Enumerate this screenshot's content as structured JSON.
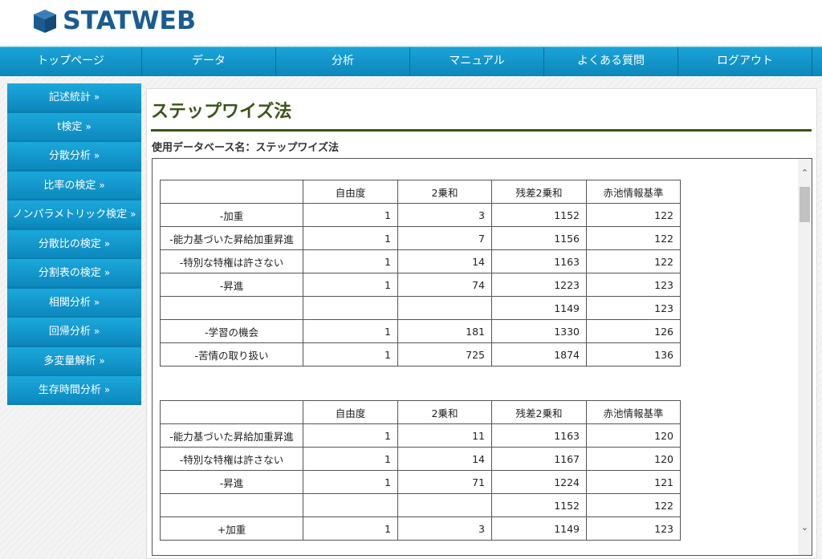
{
  "header": {
    "logo_text": "STATWEB"
  },
  "nav": {
    "items": [
      "トップページ",
      "データ",
      "分析",
      "マニュアル",
      "よくある質問",
      "ログアウト"
    ]
  },
  "sidebar": {
    "chevron": "»",
    "items": [
      "記述統計",
      "t検定",
      "分散分析",
      "比率の検定",
      "ノンパラメトリック検定",
      "分散比の検定",
      "分割表の検定",
      "相関分析",
      "回帰分析",
      "多変量解析",
      "生存時間分析"
    ]
  },
  "main": {
    "title": "ステップワイズ法",
    "db_label": "使用データベース名：ステップワイズ法"
  },
  "tables": [
    {
      "header": [
        "",
        "自由度",
        "2乗和",
        "残差2乗和",
        "赤池情報基準"
      ],
      "rows": [
        [
          "-加重",
          "1",
          "3",
          "1152",
          "122"
        ],
        [
          "-能力基づいた昇給加重昇進",
          "1",
          "7",
          "1156",
          "122"
        ],
        [
          "-特別な特権は許さない",
          "1",
          "14",
          "1163",
          "122"
        ],
        [
          "-昇進",
          "1",
          "74",
          "1223",
          "123"
        ],
        [
          "",
          "",
          "",
          "1149",
          "123"
        ],
        [
          "-学習の機会",
          "1",
          "181",
          "1330",
          "126"
        ],
        [
          "-苦情の取り扱い",
          "1",
          "725",
          "1874",
          "136"
        ]
      ]
    },
    {
      "header": [
        "",
        "自由度",
        "2乗和",
        "残差2乗和",
        "赤池情報基準"
      ],
      "rows": [
        [
          "-能力基づいた昇給加重昇進",
          "1",
          "11",
          "1163",
          "120"
        ],
        [
          "-特別な特権は許さない",
          "1",
          "14",
          "1167",
          "120"
        ],
        [
          "-昇進",
          "1",
          "71",
          "1224",
          "121"
        ],
        [
          "",
          "",
          "",
          "1152",
          "122"
        ],
        [
          "+加重",
          "1",
          "3",
          "1149",
          "123"
        ]
      ]
    }
  ],
  "icons": {
    "scroll_up": "chevron-up-icon",
    "scroll_down": "chevron-down-icon",
    "logo": "cube-logo-icon"
  },
  "colors": {
    "nav_bg": "#1aa4d8",
    "title_color": "#3b5418",
    "logo_color": "#1a5c92"
  }
}
